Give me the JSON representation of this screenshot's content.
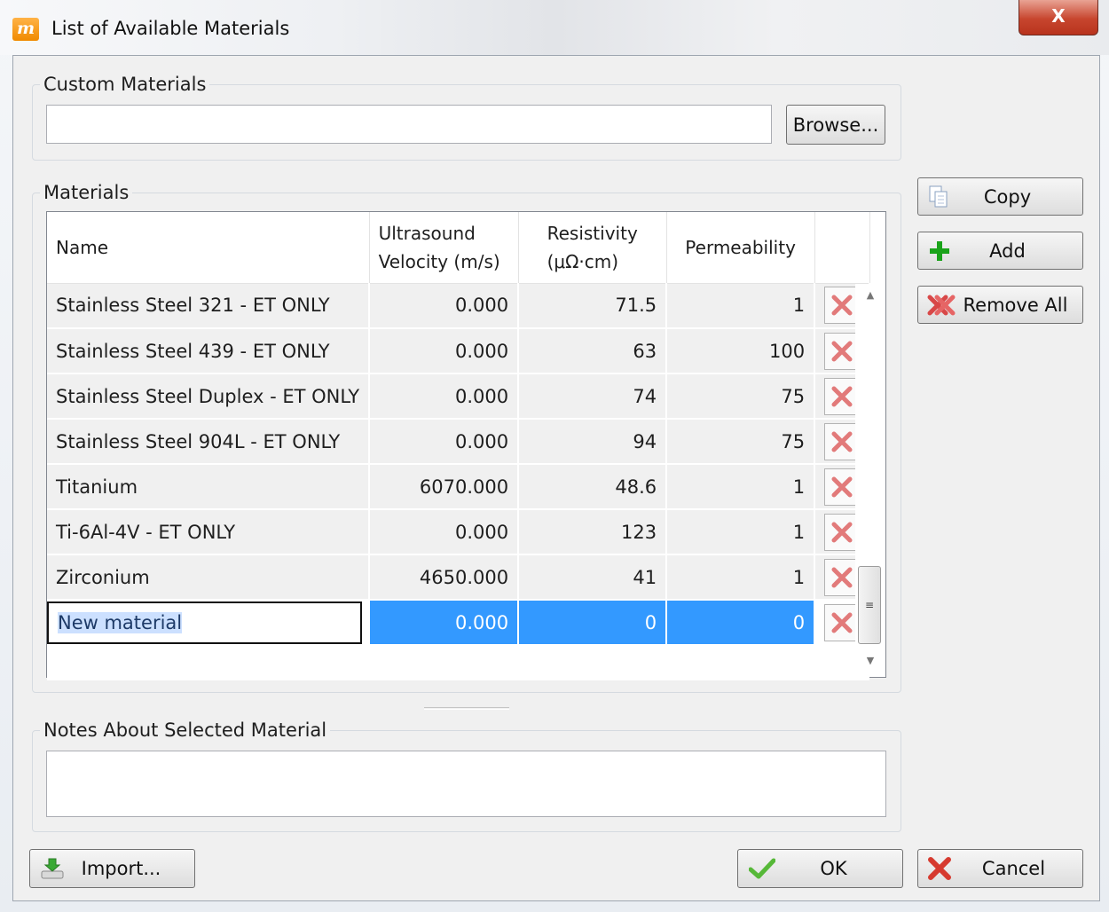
{
  "window": {
    "title": "List of Available Materials",
    "close_glyph": "X",
    "icon_letter": "m"
  },
  "custom_materials": {
    "legend": "Custom Materials",
    "path_value": "",
    "browse_label": "Browse..."
  },
  "materials": {
    "legend": "Materials",
    "columns": {
      "name": "Name",
      "ultrasound_line1": "Ultrasound",
      "ultrasound_line2": "Velocity (m/s)",
      "resistivity_line1": "Resistivity",
      "resistivity_line2": "(μΩ·cm)",
      "permeability": "Permeability"
    },
    "rows": [
      {
        "name": "Stainless Steel 321 - ET ONLY",
        "velocity": "0.000",
        "resistivity": "71.5",
        "permeability": "1"
      },
      {
        "name": "Stainless Steel 439 - ET ONLY",
        "velocity": "0.000",
        "resistivity": "63",
        "permeability": "100"
      },
      {
        "name": "Stainless Steel Duplex - ET ONLY",
        "velocity": "0.000",
        "resistivity": "74",
        "permeability": "75"
      },
      {
        "name": "Stainless Steel 904L - ET ONLY",
        "velocity": "0.000",
        "resistivity": "94",
        "permeability": "75"
      },
      {
        "name": "Titanium",
        "velocity": "6070.000",
        "resistivity": "48.6",
        "permeability": "1"
      },
      {
        "name": "Ti-6Al-4V - ET ONLY",
        "velocity": "0.000",
        "resistivity": "123",
        "permeability": "1"
      },
      {
        "name": "Zirconium",
        "velocity": "4650.000",
        "resistivity": "41",
        "permeability": "1"
      }
    ],
    "selected_row": {
      "name": "New material",
      "velocity": "0.000",
      "resistivity": "0",
      "permeability": "0"
    }
  },
  "side_buttons": {
    "copy": "Copy",
    "add": "Add",
    "remove_all": "Remove All"
  },
  "notes": {
    "legend": "Notes About Selected Material",
    "value": ""
  },
  "footer": {
    "import": "Import...",
    "ok": "OK",
    "cancel": "Cancel"
  },
  "icons": {
    "delete": "red-x-icon",
    "copy": "copy-icon",
    "add": "green-plus-icon",
    "remove_all": "red-x-multi-icon",
    "import": "import-tray-icon",
    "ok": "green-check-icon",
    "cancel": "red-x-icon"
  },
  "colors": {
    "selection": "#3399ff",
    "delete_red": "#e05a5a",
    "add_green": "#1aa31a"
  }
}
